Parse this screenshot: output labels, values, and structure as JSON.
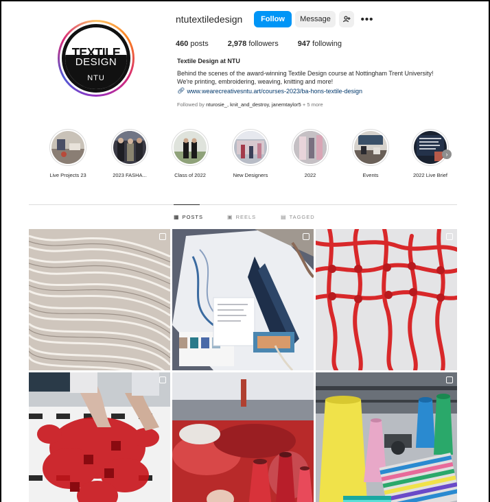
{
  "profile": {
    "username": "ntutextiledesign",
    "follow_label": "Follow",
    "message_label": "Message",
    "suggest_icon": "+&",
    "more_icon": "•••",
    "avatar_text": {
      "line1": "TEXTILE",
      "line2": "DESIGN",
      "line3": "NTU"
    },
    "stats": {
      "posts_count": "460",
      "posts_label": "posts",
      "followers_count": "2,978",
      "followers_label": "followers",
      "following_count": "947",
      "following_label": "following"
    },
    "full_name": "Textile Design at NTU",
    "bio_line1": "Behind the scenes of the award-winning Textile Design course at Nottingham Trent University!",
    "bio_line2": "We're printing, embroidering, weaving, knitting and more!",
    "website": "www.wearecreativesntu.art/courses-2023/ba-hons-textile-design",
    "followed_by_prefix": "Followed by",
    "followed_by_names": "nturosie_, knit_and_destroy, janemtaylor5",
    "followed_by_more": "+ 5 more"
  },
  "highlights": [
    {
      "label": "Live Projects 23"
    },
    {
      "label": "2023 FASHA..."
    },
    {
      "label": "Class of 2022"
    },
    {
      "label": "New Designers"
    },
    {
      "label": "2022"
    },
    {
      "label": "Events"
    },
    {
      "label": "2022 Live Brief"
    }
  ],
  "tabs": {
    "posts": "POSTS",
    "reels": "REELS",
    "tagged": "TAGGED"
  },
  "colors": {
    "accent": "#0095f6",
    "link": "#00376b"
  }
}
